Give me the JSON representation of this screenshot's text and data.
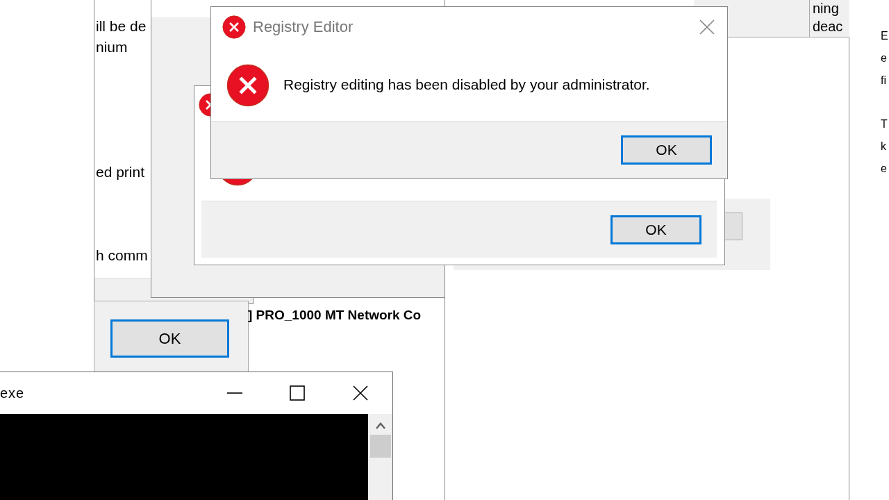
{
  "background_window": {
    "lines": [
      "ill be de",
      "nium",
      "ed print",
      "h comm"
    ]
  },
  "ok_panel": {
    "button": "OK"
  },
  "network_label": "] PRO_1000 MT Network Co",
  "right_window": {
    "column_lines": [
      "ning",
      "deac"
    ]
  },
  "edge_paragraphs": [
    [
      "E",
      "e",
      "fi"
    ],
    [
      "T",
      "k",
      "e"
    ]
  ],
  "error_dialog_back": {
    "button": "OK"
  },
  "registry_dialog": {
    "title": "Registry Editor",
    "message": "Registry editing has been disabled by your administrator.",
    "button": "OK"
  },
  "console_window": {
    "title": "exe"
  }
}
